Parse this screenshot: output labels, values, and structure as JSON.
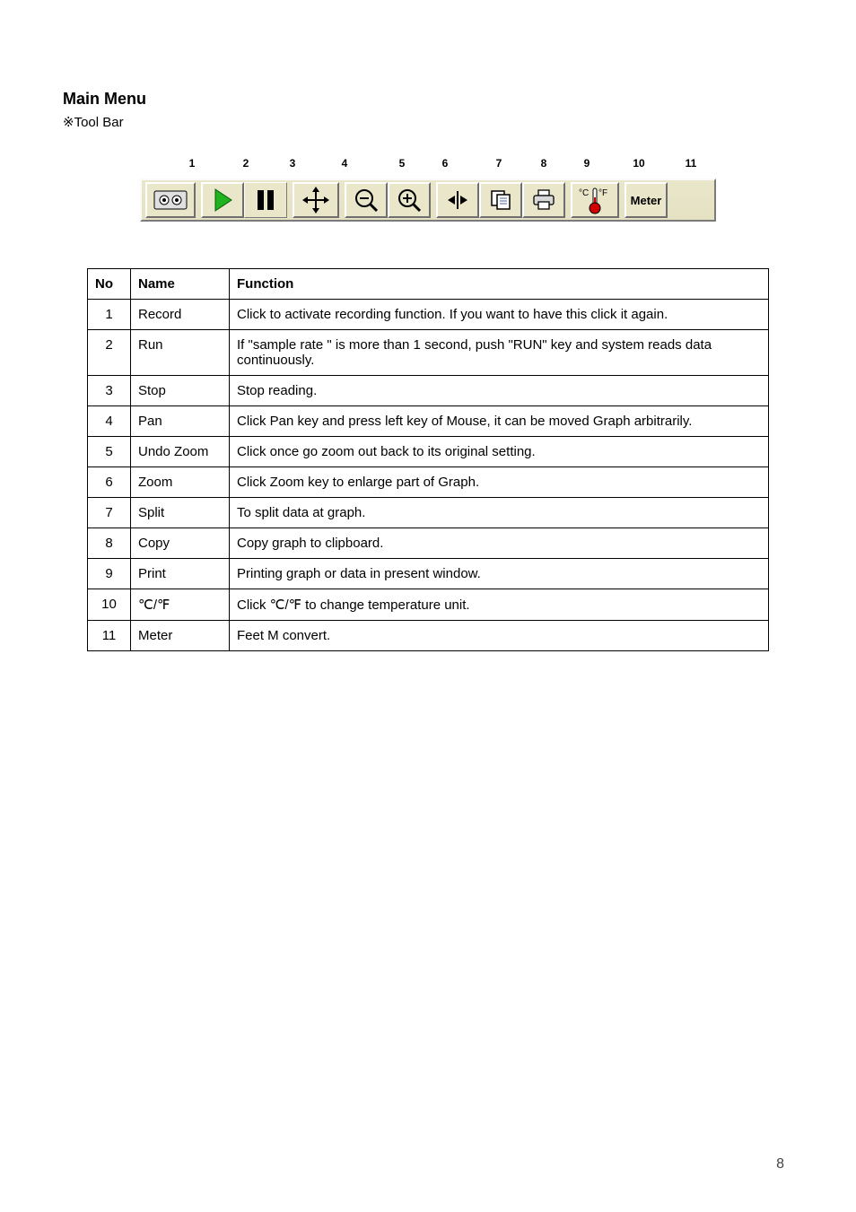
{
  "page": {
    "section_title": "Main Menu",
    "section_sub": "※Tool Bar",
    "page_number": "8"
  },
  "toolbar_numbers": [
    "1",
    "2",
    "3",
    "4",
    "5",
    "6",
    "7",
    "8",
    "9",
    "10",
    "11"
  ],
  "toolbar_meter_label": "Meter",
  "table": {
    "headers": [
      "No",
      "Name",
      "Function"
    ],
    "rows": [
      {
        "no": "1",
        "name": "Record",
        "fn": "Click to activate recording function. If you want to have this click it again."
      },
      {
        "no": "2",
        "name": "Run",
        "fn": "If \"sample rate \" is more than 1 second, push \"RUN\" key and system reads data continuously."
      },
      {
        "no": "3",
        "name": "Stop",
        "fn": "Stop reading."
      },
      {
        "no": "4",
        "name": "Pan",
        "fn": "Click Pan key and press left key of Mouse, it can be moved Graph arbitrarily."
      },
      {
        "no": "5",
        "name": "Undo Zoom",
        "fn": "Click once go zoom out back to its original setting."
      },
      {
        "no": "6",
        "name": "Zoom",
        "fn": "Click Zoom key to enlarge part of Graph."
      },
      {
        "no": "7",
        "name": "Split",
        "fn": "To split data at graph."
      },
      {
        "no": "8",
        "name": "Copy",
        "fn": "Copy graph to clipboard."
      },
      {
        "no": "9",
        "name": "Print",
        "fn": "Printing graph or data in present window."
      },
      {
        "no": "10",
        "name": "℃/℉",
        "fn": "Click ℃/℉ to change temperature unit."
      },
      {
        "no": "11",
        "name": "Meter",
        "fn": "Feet M convert."
      }
    ]
  }
}
